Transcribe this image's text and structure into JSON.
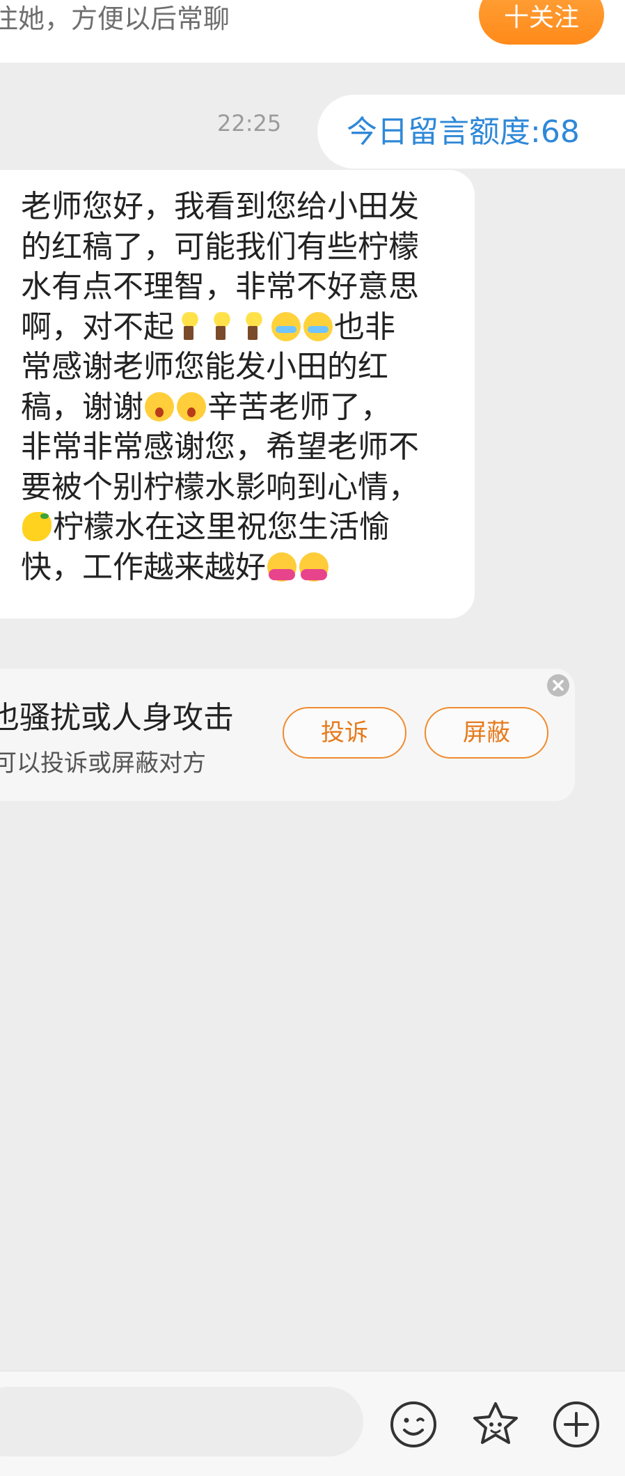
{
  "header": {
    "hint": "注她，方便以后常聊",
    "follow_label": "十关注"
  },
  "chat": {
    "time": "22:25",
    "quota_text": "今日留言额度:68",
    "message_lines": [
      {
        "parts": [
          {
            "t": "老师您好，我看到您给小田发"
          }
        ]
      },
      {
        "parts": [
          {
            "t": "的红稿了，可能我们有些柠檬"
          }
        ]
      },
      {
        "parts": [
          {
            "t": "水有点不理智，非常不好意思"
          }
        ]
      },
      {
        "parts": [
          {
            "t": "啊，对不起"
          },
          {
            "e": "torch-emoji"
          },
          {
            "e": "torch-emoji"
          },
          {
            "e": "torch-emoji"
          },
          {
            "e": "crying-emoji"
          },
          {
            "e": "crying-emoji"
          },
          {
            "t": "也非"
          }
        ]
      },
      {
        "parts": [
          {
            "t": "常感谢老师您能发小田的红"
          }
        ]
      },
      {
        "parts": [
          {
            "t": "稿，谢谢"
          },
          {
            "e": "shocked-emoji"
          },
          {
            "e": "shocked-emoji"
          },
          {
            "t": "辛苦老师了，"
          }
        ]
      },
      {
        "parts": [
          {
            "t": "非常非常感谢您，希望老师不"
          }
        ]
      },
      {
        "parts": [
          {
            "t": "要被个别柠檬水影响到心情，"
          }
        ]
      },
      {
        "parts": [
          {
            "e": "lemon-emoji"
          },
          {
            "t": "柠檬水在这里祝您生活愉"
          }
        ]
      },
      {
        "parts": [
          {
            "t": "快，工作越来越好"
          },
          {
            "e": "hug-emoji"
          },
          {
            "e": "hug-emoji"
          }
        ]
      }
    ]
  },
  "safety": {
    "title": "也骚扰或人身攻击",
    "subtitle": "可以投诉或屏蔽对方",
    "report_label": "投诉",
    "block_label": "屏蔽"
  },
  "composer": {
    "placeholder": ""
  },
  "colors": {
    "accent_orange": "#ff8a1a",
    "link_blue": "#2e88d8",
    "background": "#ededed"
  }
}
